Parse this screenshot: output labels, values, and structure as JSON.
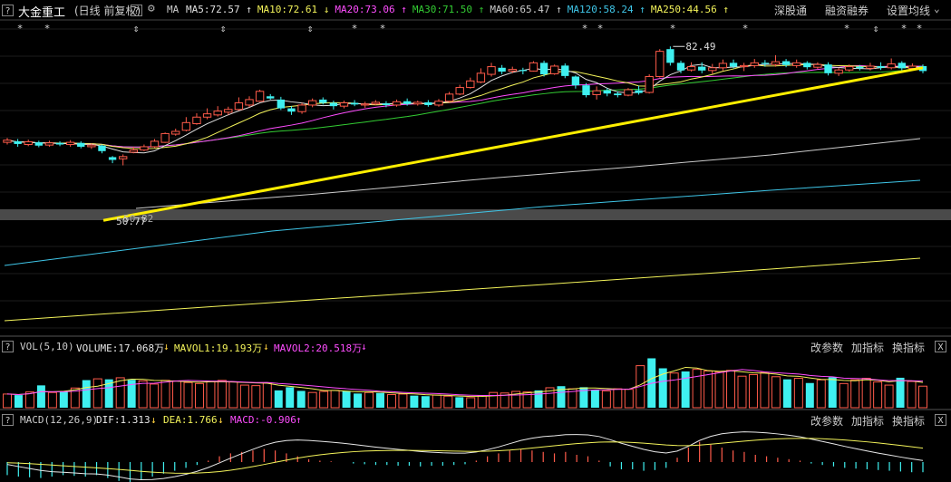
{
  "header": {
    "help": "?",
    "stock_name": "大金重工",
    "period_info": "(日线 前复权)",
    "ma_label": "MA",
    "ma_items": [
      {
        "label": "MA5:72.57",
        "arrow": "↑",
        "color": "#e0e0e0"
      },
      {
        "label": "MA10:72.61",
        "arrow": "↓",
        "color": "#f3f35a"
      },
      {
        "label": "MA20:73.06",
        "arrow": "↑",
        "color": "#ff4dff"
      },
      {
        "label": "MA30:71.50",
        "arrow": "↑",
        "color": "#33cc33"
      },
      {
        "label": "MA60:65.47",
        "arrow": "↑",
        "color": "#cccccc"
      },
      {
        "label": "MA120:58.24",
        "arrow": "↑",
        "color": "#3fc6e8"
      },
      {
        "label": "MA250:44.56",
        "arrow": "↑",
        "color": "#f3f35a"
      }
    ],
    "menu": [
      "深股通",
      "融资融券",
      "设置均线"
    ]
  },
  "price_annotations": {
    "high": "82.49",
    "low": "50.77",
    "mid": "50.82"
  },
  "volume_panel": {
    "help": "?",
    "label": "VOL(5,10)",
    "volume": "VOLUME:17.068万",
    "volume_arrow": "↓",
    "mavol1": "MAVOL1:19.193万",
    "mavol1_arrow": "↓",
    "mavol2": "MAVOL2:20.518万",
    "mavol2_arrow": "↓",
    "menu": [
      "改参数",
      "加指标",
      "换指标"
    ],
    "close": "X"
  },
  "macd_panel": {
    "help": "?",
    "label": "MACD(12,26,9)",
    "dif": "DIF:1.313",
    "dif_arrow": "↓",
    "dea": "DEA:1.766",
    "dea_arrow": "↓",
    "macd": "MACD:-0.906",
    "macd_arrow": "↑",
    "menu": [
      "改参数",
      "加指标",
      "换指标"
    ],
    "close": "X"
  },
  "colors": {
    "up": "#ff5b4a",
    "down": "#3ff0f0",
    "ma5": "#e0e0e0",
    "ma10": "#f3f35a",
    "ma20": "#ff4dff",
    "ma30": "#33cc33",
    "ma60": "#cccccc",
    "ma120": "#3fc6e8",
    "ma250": "#f3f35a",
    "trend": "#ffee00"
  },
  "candles": [
    {
      "o": 65.0,
      "c": 65.4,
      "h": 65.8,
      "l": 64.6
    },
    {
      "o": 65.2,
      "c": 64.7,
      "h": 65.6,
      "l": 64.2
    },
    {
      "o": 64.6,
      "c": 65.1,
      "h": 65.5,
      "l": 64.3
    },
    {
      "o": 65.0,
      "c": 64.4,
      "h": 65.3,
      "l": 64.1
    },
    {
      "o": 64.5,
      "c": 64.9,
      "h": 65.3,
      "l": 64.2
    },
    {
      "o": 64.9,
      "c": 64.6,
      "h": 65.2,
      "l": 64.3
    },
    {
      "o": 64.6,
      "c": 65.0,
      "h": 65.4,
      "l": 64.2
    },
    {
      "o": 64.9,
      "c": 64.2,
      "h": 65.2,
      "l": 63.9
    },
    {
      "o": 64.2,
      "c": 64.5,
      "h": 64.8,
      "l": 63.8
    },
    {
      "o": 64.4,
      "c": 63.4,
      "h": 64.6,
      "l": 63.0
    },
    {
      "o": 62.3,
      "c": 61.8,
      "h": 62.5,
      "l": 61.2
    },
    {
      "o": 62.0,
      "c": 62.4,
      "h": 62.8,
      "l": 60.8
    },
    {
      "o": 63.2,
      "c": 63.6,
      "h": 64.2,
      "l": 63.0
    },
    {
      "o": 63.6,
      "c": 64.2,
      "h": 64.6,
      "l": 63.4
    },
    {
      "o": 64.2,
      "c": 65.2,
      "h": 65.6,
      "l": 64.0
    },
    {
      "o": 65.0,
      "c": 66.6,
      "h": 66.8,
      "l": 64.9
    },
    {
      "o": 66.5,
      "c": 67.0,
      "h": 67.5,
      "l": 66.2
    },
    {
      "o": 67.2,
      "c": 68.6,
      "h": 69.6,
      "l": 67.0
    },
    {
      "o": 68.4,
      "c": 69.6,
      "h": 70.3,
      "l": 68.2
    },
    {
      "o": 69.6,
      "c": 70.2,
      "h": 71.2,
      "l": 69.2
    },
    {
      "o": 70.0,
      "c": 70.7,
      "h": 71.6,
      "l": 69.7
    },
    {
      "o": 70.5,
      "c": 71.0,
      "h": 71.5,
      "l": 70.0
    },
    {
      "o": 71.0,
      "c": 72.2,
      "h": 73.2,
      "l": 70.8
    },
    {
      "o": 71.8,
      "c": 72.8,
      "h": 73.4,
      "l": 71.4
    },
    {
      "o": 72.5,
      "c": 74.3,
      "h": 74.6,
      "l": 72.4
    },
    {
      "o": 73.4,
      "c": 73.0,
      "h": 73.8,
      "l": 72.8
    },
    {
      "o": 72.8,
      "c": 71.2,
      "h": 73.3,
      "l": 70.9
    },
    {
      "o": 71.2,
      "c": 70.6,
      "h": 71.6,
      "l": 70.0
    },
    {
      "o": 70.6,
      "c": 71.8,
      "h": 72.2,
      "l": 70.2
    },
    {
      "o": 71.8,
      "c": 72.6,
      "h": 73.0,
      "l": 71.4
    },
    {
      "o": 72.8,
      "c": 72.2,
      "h": 73.2,
      "l": 71.9
    },
    {
      "o": 72.2,
      "c": 71.6,
      "h": 72.6,
      "l": 71.0
    },
    {
      "o": 71.6,
      "c": 72.2,
      "h": 72.6,
      "l": 71.2
    },
    {
      "o": 72.2,
      "c": 71.9,
      "h": 72.7,
      "l": 71.6
    },
    {
      "o": 71.8,
      "c": 72.0,
      "h": 72.4,
      "l": 71.3
    },
    {
      "o": 72.0,
      "c": 72.3,
      "h": 72.7,
      "l": 71.8
    },
    {
      "o": 72.1,
      "c": 71.8,
      "h": 72.5,
      "l": 71.4
    },
    {
      "o": 71.8,
      "c": 72.4,
      "h": 72.8,
      "l": 71.5
    },
    {
      "o": 72.5,
      "c": 72.0,
      "h": 73.0,
      "l": 71.7
    },
    {
      "o": 72.0,
      "c": 72.3,
      "h": 72.6,
      "l": 71.7
    },
    {
      "o": 72.3,
      "c": 71.8,
      "h": 72.7,
      "l": 71.5
    },
    {
      "o": 71.8,
      "c": 72.5,
      "h": 72.9,
      "l": 71.5
    },
    {
      "o": 72.5,
      "c": 73.8,
      "h": 74.2,
      "l": 72.3
    },
    {
      "o": 73.8,
      "c": 75.0,
      "h": 75.5,
      "l": 73.6
    },
    {
      "o": 75.0,
      "c": 76.2,
      "h": 76.8,
      "l": 74.8
    },
    {
      "o": 76.0,
      "c": 77.6,
      "h": 78.5,
      "l": 75.8
    },
    {
      "o": 77.4,
      "c": 78.8,
      "h": 79.5,
      "l": 77.0
    },
    {
      "o": 78.6,
      "c": 77.9,
      "h": 79.1,
      "l": 77.4
    },
    {
      "o": 78.0,
      "c": 78.3,
      "h": 78.8,
      "l": 77.6
    },
    {
      "o": 78.2,
      "c": 78.0,
      "h": 78.6,
      "l": 77.4
    },
    {
      "o": 78.0,
      "c": 79.5,
      "h": 79.8,
      "l": 77.9
    },
    {
      "o": 79.5,
      "c": 77.4,
      "h": 79.9,
      "l": 77.0
    },
    {
      "o": 77.5,
      "c": 78.9,
      "h": 79.2,
      "l": 77.3
    },
    {
      "o": 79.0,
      "c": 77.1,
      "h": 79.4,
      "l": 76.7
    },
    {
      "o": 77.0,
      "c": 75.4,
      "h": 77.2,
      "l": 74.8
    },
    {
      "o": 75.4,
      "c": 73.6,
      "h": 75.8,
      "l": 73.2
    },
    {
      "o": 73.7,
      "c": 74.4,
      "h": 75.2,
      "l": 72.8
    },
    {
      "o": 74.5,
      "c": 73.9,
      "h": 74.9,
      "l": 73.4
    },
    {
      "o": 73.9,
      "c": 73.6,
      "h": 74.3,
      "l": 73.2
    },
    {
      "o": 73.6,
      "c": 74.6,
      "h": 74.9,
      "l": 73.4
    },
    {
      "o": 74.5,
      "c": 74.0,
      "h": 75.3,
      "l": 73.7
    },
    {
      "o": 74.1,
      "c": 77.0,
      "h": 77.4,
      "l": 73.9
    },
    {
      "o": 77.0,
      "c": 81.6,
      "h": 82.0,
      "l": 76.8
    },
    {
      "o": 82.0,
      "c": 79.5,
      "h": 82.49,
      "l": 79.0
    },
    {
      "o": 79.5,
      "c": 78.1,
      "h": 79.9,
      "l": 77.6
    },
    {
      "o": 78.2,
      "c": 78.8,
      "h": 79.6,
      "l": 77.9
    },
    {
      "o": 78.8,
      "c": 78.1,
      "h": 79.6,
      "l": 77.6
    },
    {
      "o": 78.1,
      "c": 78.6,
      "h": 79.3,
      "l": 77.5
    },
    {
      "o": 78.6,
      "c": 79.4,
      "h": 80.1,
      "l": 78.1
    },
    {
      "o": 79.5,
      "c": 78.8,
      "h": 80.1,
      "l": 78.5
    },
    {
      "o": 78.8,
      "c": 79.0,
      "h": 79.5,
      "l": 78.0
    },
    {
      "o": 79.0,
      "c": 79.5,
      "h": 80.2,
      "l": 78.6
    },
    {
      "o": 79.5,
      "c": 79.3,
      "h": 80.0,
      "l": 78.8
    },
    {
      "o": 79.2,
      "c": 79.7,
      "h": 80.9,
      "l": 78.8
    },
    {
      "o": 79.8,
      "c": 79.1,
      "h": 80.2,
      "l": 78.7
    },
    {
      "o": 79.0,
      "c": 79.5,
      "h": 80.1,
      "l": 78.6
    },
    {
      "o": 79.5,
      "c": 78.7,
      "h": 79.8,
      "l": 78.3
    },
    {
      "o": 78.7,
      "c": 79.2,
      "h": 79.6,
      "l": 78.4
    },
    {
      "o": 79.2,
      "c": 77.6,
      "h": 79.6,
      "l": 77.2
    },
    {
      "o": 77.6,
      "c": 78.2,
      "h": 78.6,
      "l": 77.1
    },
    {
      "o": 78.2,
      "c": 78.8,
      "h": 79.2,
      "l": 77.9
    },
    {
      "o": 78.8,
      "c": 78.5,
      "h": 79.1,
      "l": 78.1
    },
    {
      "o": 78.5,
      "c": 78.9,
      "h": 79.5,
      "l": 78.1
    },
    {
      "o": 78.9,
      "c": 78.6,
      "h": 79.6,
      "l": 78.2
    },
    {
      "o": 78.6,
      "c": 79.3,
      "h": 80.3,
      "l": 78.3
    },
    {
      "o": 79.5,
      "c": 78.5,
      "h": 79.8,
      "l": 78.0
    },
    {
      "o": 78.5,
      "c": 78.9,
      "h": 79.4,
      "l": 78.1
    },
    {
      "o": 78.9,
      "c": 78.0,
      "h": 79.2,
      "l": 77.6
    }
  ],
  "volume": [
    {
      "v": 5.2,
      "up": true
    },
    {
      "v": 4.8,
      "up": false
    },
    {
      "v": 6.0,
      "up": true
    },
    {
      "v": 8.5,
      "up": false
    },
    {
      "v": 5.8,
      "up": true
    },
    {
      "v": 6.2,
      "up": false
    },
    {
      "v": 7.5,
      "up": true
    },
    {
      "v": 10.5,
      "up": false
    },
    {
      "v": 11.0,
      "up": true
    },
    {
      "v": 10.8,
      "up": false
    },
    {
      "v": 11.4,
      "up": true
    },
    {
      "v": 10.6,
      "up": false
    },
    {
      "v": 10.2,
      "up": true
    },
    {
      "v": 9.0,
      "up": true
    },
    {
      "v": 10.4,
      "up": true
    },
    {
      "v": 10.2,
      "up": true
    },
    {
      "v": 9.6,
      "up": true
    },
    {
      "v": 9.2,
      "up": true
    },
    {
      "v": 10.0,
      "up": true
    },
    {
      "v": 10.4,
      "up": true
    },
    {
      "v": 9.8,
      "up": true
    },
    {
      "v": 8.6,
      "up": true
    },
    {
      "v": 8.4,
      "up": true
    },
    {
      "v": 9.4,
      "up": true
    },
    {
      "v": 6.6,
      "up": false
    },
    {
      "v": 7.8,
      "up": false
    },
    {
      "v": 6.4,
      "up": false
    },
    {
      "v": 5.8,
      "up": true
    },
    {
      "v": 6.2,
      "up": true
    },
    {
      "v": 6.6,
      "up": true
    },
    {
      "v": 6.4,
      "up": false
    },
    {
      "v": 5.4,
      "up": false
    },
    {
      "v": 5.8,
      "up": true
    },
    {
      "v": 5.6,
      "up": false
    },
    {
      "v": 5.0,
      "up": true
    },
    {
      "v": 5.2,
      "up": true
    },
    {
      "v": 4.6,
      "up": false
    },
    {
      "v": 4.4,
      "up": false
    },
    {
      "v": 4.8,
      "up": true
    },
    {
      "v": 4.4,
      "up": true
    },
    {
      "v": 4.0,
      "up": false
    },
    {
      "v": 3.8,
      "up": true
    },
    {
      "v": 4.6,
      "up": true
    },
    {
      "v": 5.8,
      "up": true
    },
    {
      "v": 5.6,
      "up": true
    },
    {
      "v": 6.2,
      "up": true
    },
    {
      "v": 6.0,
      "up": true
    },
    {
      "v": 6.6,
      "up": false
    },
    {
      "v": 7.6,
      "up": true
    },
    {
      "v": 8.2,
      "up": false
    },
    {
      "v": 7.2,
      "up": true
    },
    {
      "v": 7.8,
      "up": false
    },
    {
      "v": 6.8,
      "up": false
    },
    {
      "v": 6.4,
      "up": true
    },
    {
      "v": 7.2,
      "up": true
    },
    {
      "v": 7.0,
      "up": true
    },
    {
      "v": 16.0,
      "up": true
    },
    {
      "v": 18.8,
      "up": false
    },
    {
      "v": 15.0,
      "up": false
    },
    {
      "v": 13.2,
      "up": true
    },
    {
      "v": 13.8,
      "up": false
    },
    {
      "v": 14.6,
      "up": true
    },
    {
      "v": 14.0,
      "up": true
    },
    {
      "v": 13.6,
      "up": true
    },
    {
      "v": 14.2,
      "up": true
    },
    {
      "v": 12.0,
      "up": true
    },
    {
      "v": 12.6,
      "up": true
    },
    {
      "v": 13.4,
      "up": true
    },
    {
      "v": 11.8,
      "up": true
    },
    {
      "v": 10.8,
      "up": false
    },
    {
      "v": 11.2,
      "up": true
    },
    {
      "v": 9.4,
      "up": false
    },
    {
      "v": 10.6,
      "up": true
    },
    {
      "v": 11.6,
      "up": false
    },
    {
      "v": 9.2,
      "up": true
    },
    {
      "v": 10.6,
      "up": true
    },
    {
      "v": 11.2,
      "up": true
    },
    {
      "v": 9.8,
      "up": true
    },
    {
      "v": 8.6,
      "up": true
    },
    {
      "v": 11.4,
      "up": false
    },
    {
      "v": 10.0,
      "up": true
    },
    {
      "v": 8.2,
      "up": true
    }
  ],
  "macd_hist": [
    -1.8,
    -2.0,
    -2.1,
    -2.2,
    -2.0,
    -1.8,
    -1.9,
    -2.0,
    -1.8,
    -2.2,
    -2.6,
    -2.8,
    -2.4,
    -2.0,
    -1.6,
    -1.2,
    -0.8,
    -0.4,
    0.2,
    0.8,
    1.2,
    1.4,
    1.6,
    1.8,
    1.6,
    1.2,
    0.8,
    0.4,
    0.2,
    0.1,
    0.0,
    -0.2,
    -0.3,
    -0.4,
    -0.4,
    -0.5,
    -0.5,
    -0.6,
    -0.5,
    -0.5,
    -0.4,
    -0.3,
    0.2,
    0.8,
    1.2,
    1.6,
    1.8,
    1.6,
    1.4,
    1.2,
    1.4,
    1.0,
    0.8,
    0.2,
    -0.6,
    -1.0,
    -1.0,
    -1.2,
    -1.1,
    -0.8,
    0.6,
    2.0,
    2.8,
    2.4,
    2.0,
    1.6,
    1.4,
    1.0,
    0.8,
    0.6,
    0.4,
    0.2,
    -0.2,
    -0.4,
    -0.6,
    -0.8,
    -0.9,
    -1.0,
    -1.1,
    -1.2,
    -1.3,
    -1.4,
    -1.4
  ]
}
